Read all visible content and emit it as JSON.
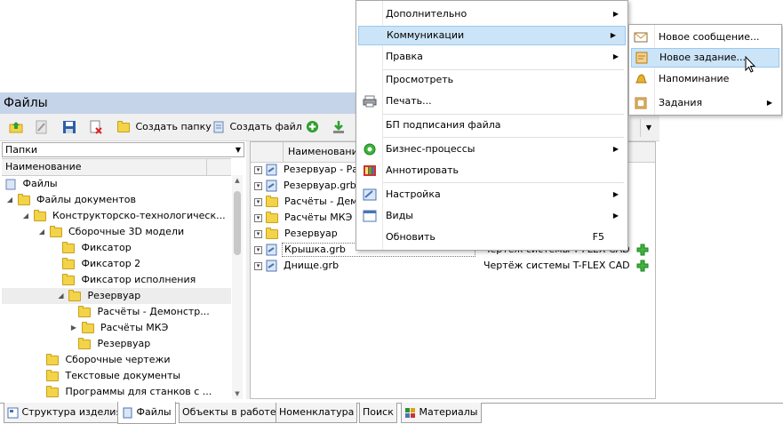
{
  "window": {
    "title": "Файлы"
  },
  "toolbar": {
    "create_folder": "Создать папку",
    "create_file": "Создать файл"
  },
  "left_panel": {
    "selector": "Папки",
    "column_header": "Наименование",
    "tree": [
      {
        "label": "Файлы"
      },
      {
        "label": "Файлы документов"
      },
      {
        "label": "Конструкторско-технологическ..."
      },
      {
        "label": "Сборочные 3D модели"
      },
      {
        "label": "Фиксатор"
      },
      {
        "label": "Фиксатор 2"
      },
      {
        "label": "Фиксатор исполнения"
      },
      {
        "label": "Резервуар"
      },
      {
        "label": "Расчёты - Демонстр..."
      },
      {
        "label": "Расчёты МКЭ"
      },
      {
        "label": "Резервуар"
      },
      {
        "label": "Сборочные чертежи"
      },
      {
        "label": "Текстовые документы"
      },
      {
        "label": "Программы для станков с ..."
      }
    ]
  },
  "right_panel": {
    "column_header": "Наименование",
    "rows": [
      {
        "name": "Резервуар - Ра",
        "type": ""
      },
      {
        "name": "Резервуар.grb",
        "type": ""
      },
      {
        "name": "Расчёты - Демо",
        "type": ""
      },
      {
        "name": "Расчёты МКЭ",
        "type": ""
      },
      {
        "name": "Резервуар",
        "type": ""
      },
      {
        "name": "Крышка.grb",
        "type": "Чертёж системы T-FLEX CAD"
      },
      {
        "name": "Днище.grb",
        "type": "Чертёж системы T-FLEX CAD"
      }
    ]
  },
  "bottom_tabs": [
    "Структура изделия",
    "Файлы",
    "Объекты в работе",
    "Номенклатура",
    "Поиск",
    "Материалы"
  ],
  "context_menu": {
    "items": [
      {
        "label": "Дополнительно"
      },
      {
        "label": "Коммуникации"
      },
      {
        "label": "Правка"
      },
      {
        "label": "Просмотреть"
      },
      {
        "label": "Печать..."
      },
      {
        "label": "БП подписания файла"
      },
      {
        "label": "Бизнес-процессы"
      },
      {
        "label": "Аннотировать"
      },
      {
        "label": "Настройка"
      },
      {
        "label": "Виды"
      },
      {
        "label": "Обновить",
        "shortcut": "F5"
      }
    ]
  },
  "submenu": {
    "items": [
      {
        "label": "Новое сообщение..."
      },
      {
        "label": "Новое задание..."
      },
      {
        "label": "Напоминание"
      },
      {
        "label": "Задания"
      }
    ]
  },
  "colors": {
    "highlight": "#cce4f7",
    "title_bar": "#c4d3e8",
    "green": "#27a327"
  }
}
